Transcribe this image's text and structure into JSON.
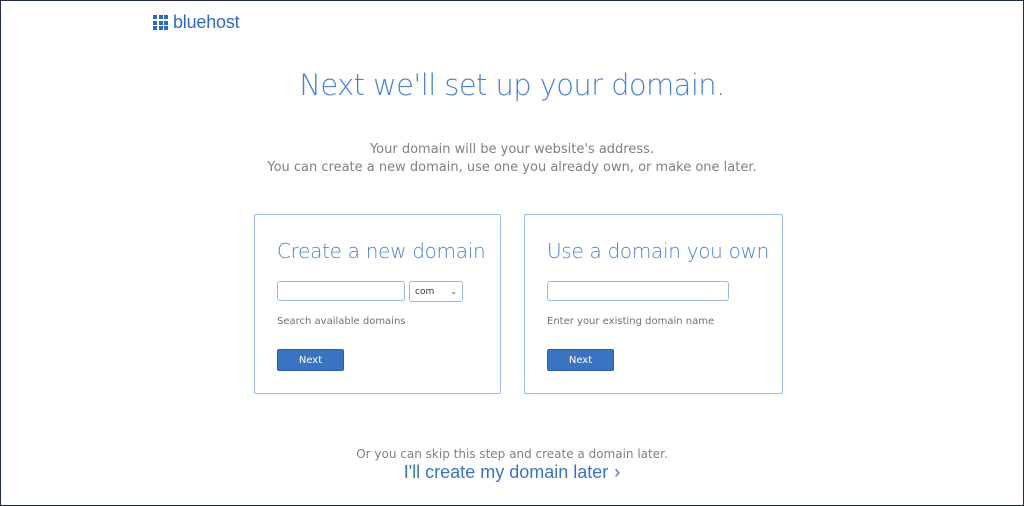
{
  "logo": {
    "text": "bluehost"
  },
  "headline": "Next we'll set up your domain.",
  "subtitle": {
    "line1": "Your domain will be your website's address.",
    "line2": "You can create a new domain, use one you already own, or make one later."
  },
  "create_card": {
    "title": "Create a new domain",
    "input_value": "",
    "tld_selected": "com",
    "helper": "Search available domains",
    "button_label": "Next"
  },
  "own_card": {
    "title": "Use a domain you own",
    "input_value": "",
    "helper": "Enter your existing domain name",
    "button_label": "Next"
  },
  "footer": {
    "skip_text": "Or you can skip this step and create a domain later.",
    "later_link": "I'll create my domain later"
  },
  "icons": {
    "logo": "grid-logo-icon",
    "tld_dropdown": "chevron-down-icon",
    "later_link": "chevron-right-icon"
  },
  "colors": {
    "brand": "#2f6bbd",
    "heading": "#4a82cf",
    "button": "#3a73c2",
    "card_border": "#9fbce6"
  }
}
